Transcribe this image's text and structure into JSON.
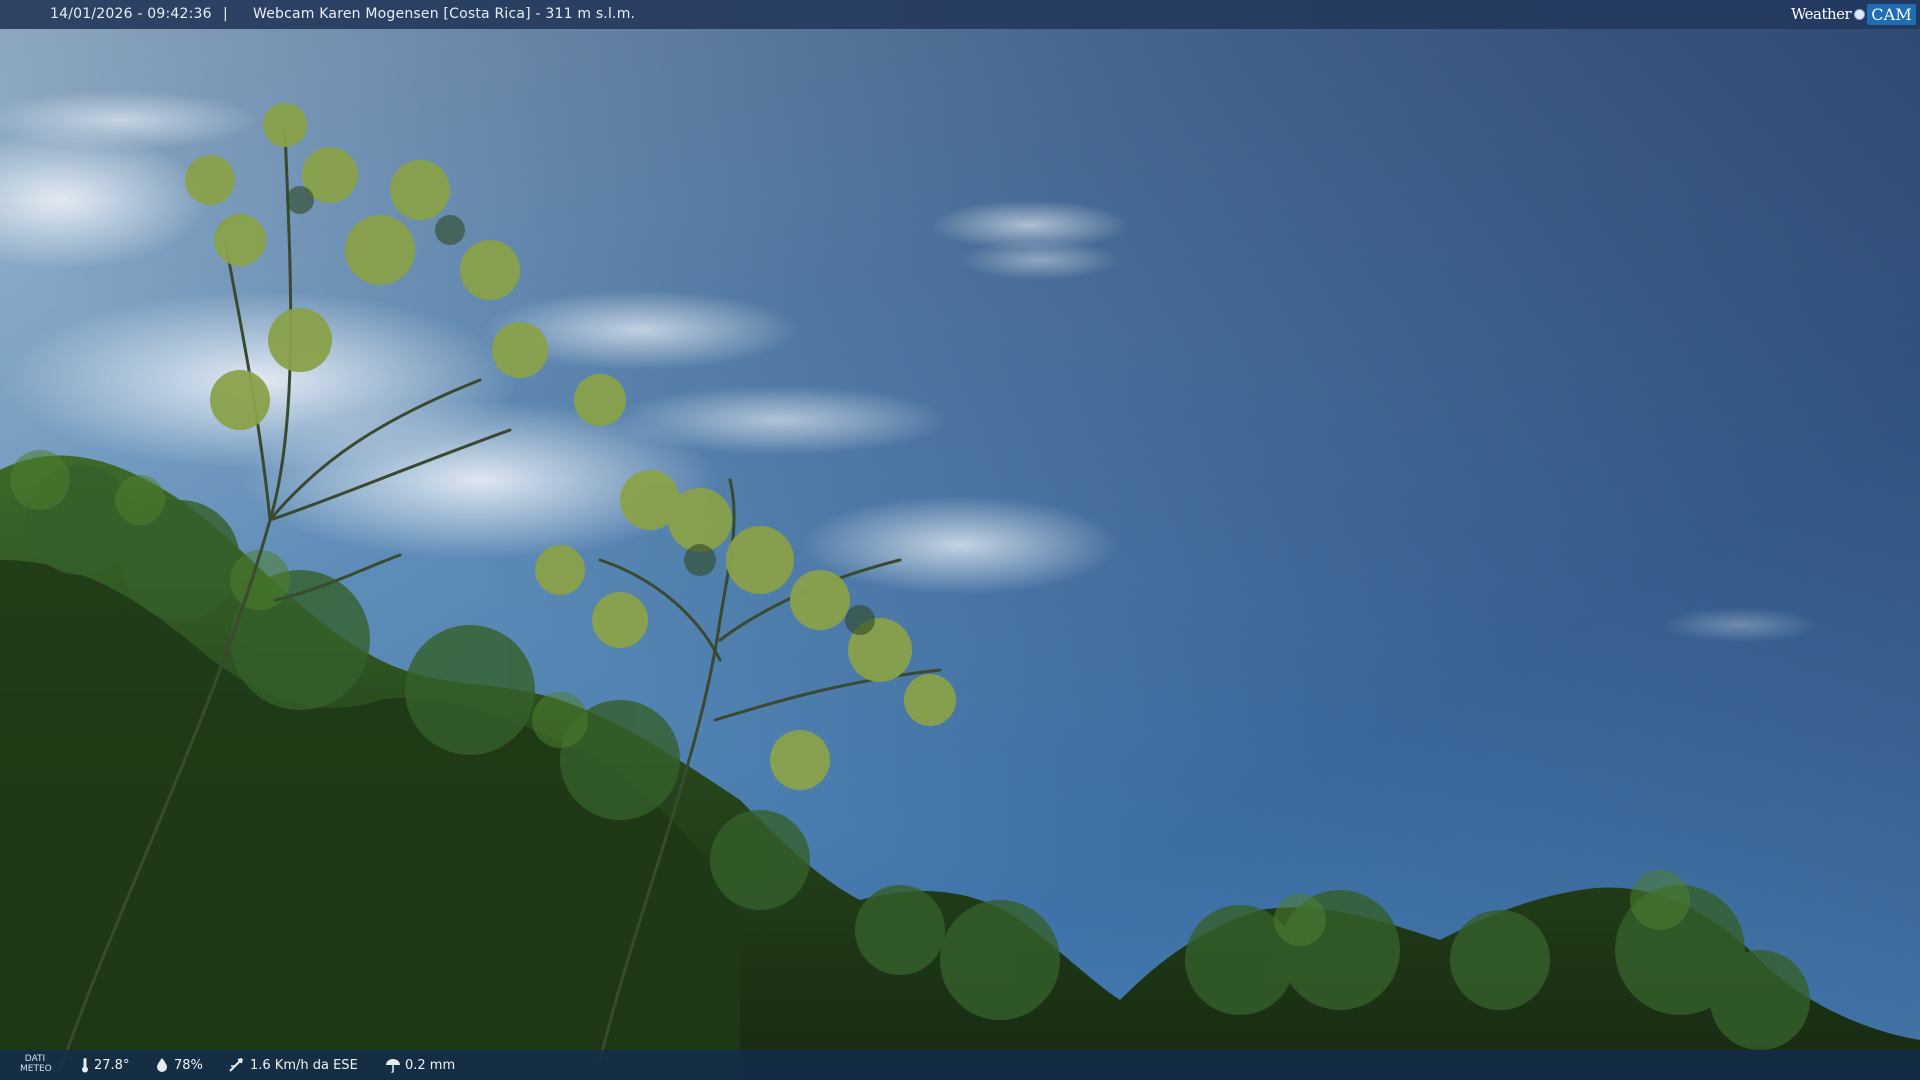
{
  "header": {
    "timestamp": "14/01/2026 - 09:42:36",
    "separator": "|",
    "title": "Webcam Karen Mogensen [Costa Rica] - 311 m s.l.m.",
    "brand_weather": "Weather",
    "brand_cam": "CAM"
  },
  "footer": {
    "label_line1": "DATI",
    "label_line2": "METEO",
    "temperature": "27.8°",
    "humidity": "78%",
    "wind": "1.6 Km/h da ESE",
    "rain": "0.2 mm",
    "icons": [
      "thermometer-icon",
      "humidity-drop-icon",
      "wind-icon",
      "rain-icon"
    ]
  },
  "scene": {
    "description_colors": {
      "sky_top": "#4a6f9a",
      "sky_mid": "#3f7fb8",
      "sky_low": "#5b93c4",
      "foliage_dark": "#1d3318",
      "foliage_mid": "#2f5426",
      "foliage_light": "#7a9a3a",
      "cloud": "#eef3f8"
    }
  }
}
